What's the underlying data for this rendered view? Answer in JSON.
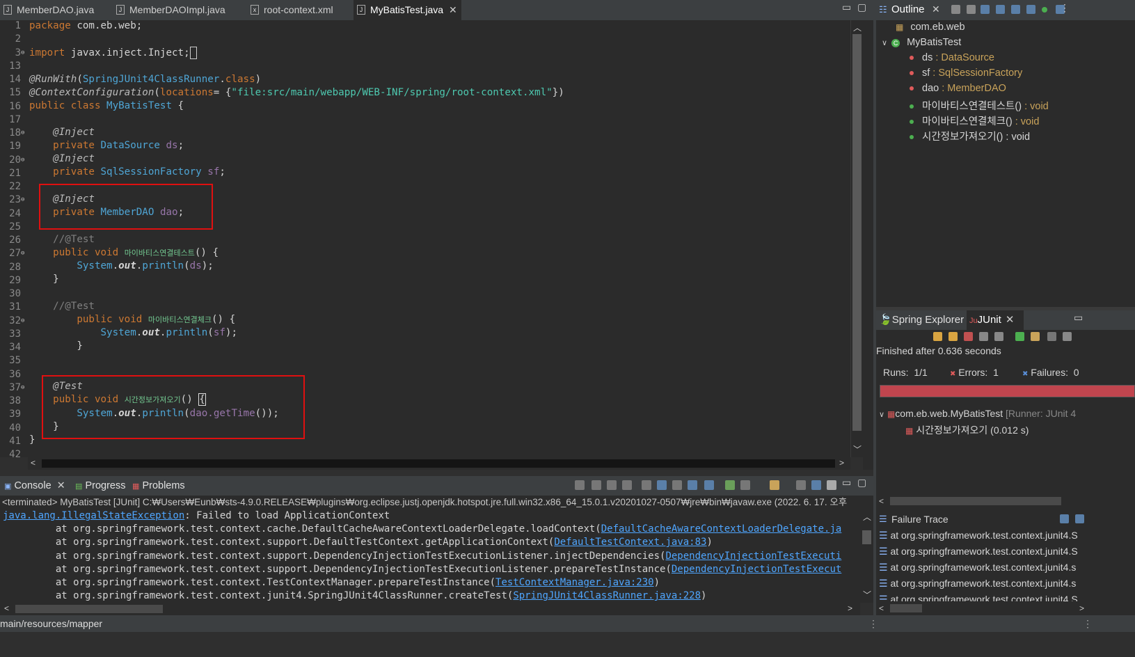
{
  "editor_tabs": [
    {
      "label": "MemberDAO.java",
      "icon": "java-file-icon",
      "active": false
    },
    {
      "label": "MemberDAOImpl.java",
      "icon": "java-file-icon",
      "active": false
    },
    {
      "label": "root-context.xml",
      "icon": "xml-file-icon",
      "active": false
    },
    {
      "label": "MyBatisTest.java",
      "icon": "java-file-icon",
      "active": true
    }
  ],
  "editor": {
    "line_numbers": [
      "1",
      "2",
      "3",
      "13",
      "14",
      "15",
      "16",
      "17",
      "18",
      "19",
      "20",
      "21",
      "22",
      "23",
      "24",
      "25",
      "26",
      "27",
      "28",
      "29",
      "30",
      "31",
      "32",
      "33",
      "34",
      "35",
      "36",
      "37",
      "38",
      "39",
      "40",
      "41",
      "42"
    ],
    "lines": {
      "l1": "package com.eb.web;",
      "l3_import": "import",
      "l3_rest": " javax.inject.Inject;",
      "l14_ann": "@RunWith",
      "l14_type": "SpringJUnit4ClassRunner",
      "l14_kw": "class",
      "l15_ann": "@ContextConfiguration",
      "l15_attr": "locations",
      "l15_eq": "= {",
      "l15_str": "\"file:src/main/webapp/WEB-INF/spring/root-context.xml\"",
      "l15_end": "})",
      "l16_kw": "public class",
      "l16_type": "MyBatisTest",
      "l16_end": " {",
      "inject": "@Inject",
      "private": "private",
      "ds_type": "DataSource",
      "ds_name": "ds",
      "sf_type": "SqlSessionFactory",
      "sf_name": "sf",
      "dao_type": "MemberDAO",
      "dao_name": "dao",
      "comment_test": "//@Test",
      "public_void": "public void",
      "m1_name": "마이바티스연결테스트",
      "m2_name": "마이바티스연결체크",
      "m3_name": "시간정보가져오기",
      "system": "System",
      "out": "out",
      "println": "println",
      "test_ann": "@Test",
      "dao_gettime": "dao.getTime",
      "close_brace": "}"
    }
  },
  "console": {
    "tabs": [
      "Console",
      "Progress",
      "Problems"
    ],
    "status": "<terminated> MyBatisTest [JUnit] C:₩Users₩Eunb₩sts-4.9.0.RELEASE₩plugins₩org.eclipse.justj.openjdk.hotspot.jre.full.win32.x86_64_15.0.1.v20201027-0507₩jre₩bin₩javaw.exe  (2022. 6. 17. 오후",
    "lines": [
      {
        "pre": "",
        "link": "java.lang.IllegalStateException",
        "post": ": Failed to load ApplicationContext"
      },
      {
        "pre": "\tat org.springframework.test.context.cache.DefaultCacheAwareContextLoaderDelegate.loadContext(",
        "link": "DefaultCacheAwareContextLoaderDelegate.ja",
        "post": ""
      },
      {
        "pre": "\tat org.springframework.test.context.support.DefaultTestContext.getApplicationContext(",
        "link": "DefaultTestContext.java:83",
        "post": ")"
      },
      {
        "pre": "\tat org.springframework.test.context.support.DependencyInjectionTestExecutionListener.injectDependencies(",
        "link": "DependencyInjectionTestExecuti",
        "post": ""
      },
      {
        "pre": "\tat org.springframework.test.context.support.DependencyInjectionTestExecutionListener.prepareTestInstance(",
        "link": "DependencyInjectionTestExecut",
        "post": ""
      },
      {
        "pre": "\tat org.springframework.test.context.TestContextManager.prepareTestInstance(",
        "link": "TestContextManager.java:230",
        "post": ")"
      },
      {
        "pre": "\tat org.springframework.test.context.junit4.SpringJUnit4ClassRunner.createTest(",
        "link": "SpringJUnit4ClassRunner.java:228",
        "post": ")"
      }
    ]
  },
  "status_bar": {
    "text": "main/resources/mapper"
  },
  "outline": {
    "title": "Outline",
    "package": "com.eb.web",
    "class_name": "MyBatisTest",
    "members": [
      {
        "name": "ds",
        "type": " : DataSource",
        "kind": "private-field"
      },
      {
        "name": "sf",
        "type": " : SqlSessionFactory",
        "kind": "private-field"
      },
      {
        "name": "dao",
        "type": " : MemberDAO",
        "kind": "private-field"
      },
      {
        "name": "마이바티스연결테스트()",
        "type": " : void",
        "kind": "public-method"
      },
      {
        "name": "마이바티스연결체크()",
        "type": " : void",
        "kind": "public-method"
      },
      {
        "name": "시간정보가져오기()",
        "type": " : void",
        "kind": "public-method"
      }
    ]
  },
  "junit": {
    "tabs": [
      "Spring Explorer",
      "JUnit"
    ],
    "finished": "Finished after 0.636 seconds",
    "runs_label": "Runs:",
    "runs_value": "1/1",
    "errors_label": "Errors:",
    "errors_value": "1",
    "failures_label": "Failures:",
    "failures_value": "0",
    "progress_color": "#c0454e",
    "tree_root": "com.eb.web.MyBatisTest",
    "tree_root_runner": "[Runner: JUnit 4",
    "tree_child": "시간정보가져오기",
    "tree_child_time": "(0.012 s)",
    "failure_trace_title": "Failure Trace",
    "trace_lines": [
      "at org.springframework.test.context.junit4.S",
      "at org.springframework.test.context.junit4.S",
      "at org.springframework.test.context.junit4.s",
      "at org.springframework.test.context.junit4.s",
      "at org.springframework.test.context.junit4.S"
    ]
  },
  "colors": {
    "accent_red": "#e01010",
    "link": "#4fa6ff",
    "background": "#2b2b2b"
  }
}
